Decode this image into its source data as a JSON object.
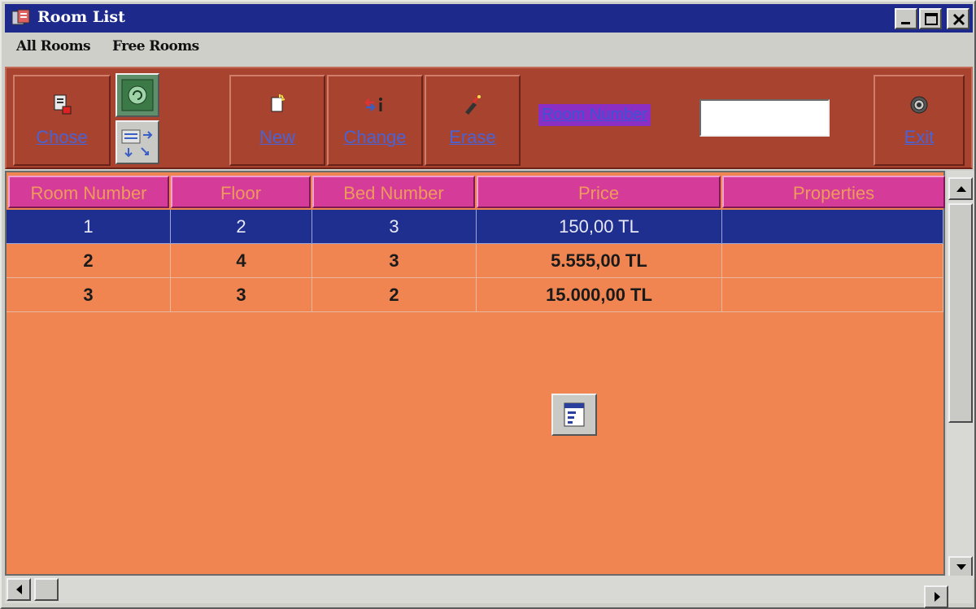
{
  "window": {
    "title": "Room List",
    "app_icon": "app-icon",
    "title_bar_color": "#1d2a8c"
  },
  "title_buttons": {
    "minimize_icon": "minimize-icon",
    "maximize_icon": "maximize-icon",
    "close_icon": "close-icon"
  },
  "menu": {
    "items": [
      {
        "label": "All Rooms"
      },
      {
        "label": "Free Rooms"
      }
    ]
  },
  "toolbar": {
    "background": "#a8432f",
    "chose": {
      "label": "Chose",
      "icon": "document-icon"
    },
    "new": {
      "label": "New",
      "icon": "new-document-icon"
    },
    "change": {
      "label": "Change",
      "icon": "change-icon"
    },
    "erase": {
      "label": "Erase",
      "icon": "eraser-icon"
    },
    "exit": {
      "label": "Exit",
      "icon": "exit-icon"
    },
    "room_number_label": "Room Number",
    "room_number_value": "",
    "small_buttons": [
      "refresh-icon",
      "transfer-icon"
    ]
  },
  "grid": {
    "header_color": "#d53c9a",
    "body_color": "#f08552",
    "selected_row_color": "#1e2f8f",
    "columns": [
      "Room Number",
      "Floor",
      "Bed Number",
      "Price",
      "Properties"
    ],
    "rows": [
      {
        "room": "1",
        "floor": "2",
        "beds": "3",
        "price": "150,00 TL",
        "properties": "",
        "selected": true
      },
      {
        "room": "2",
        "floor": "4",
        "beds": "3",
        "price": "5.555,00 TL",
        "properties": "",
        "selected": false
      },
      {
        "room": "3",
        "floor": "3",
        "beds": "2",
        "price": "15.000,00 TL",
        "properties": "",
        "selected": false
      }
    ],
    "floating_icon": "list-icon"
  },
  "scrollbars": {
    "up_icon": "arrow-up-icon",
    "down_icon": "arrow-down-icon",
    "left_icon": "arrow-left-icon",
    "right_icon": "arrow-right-icon"
  }
}
